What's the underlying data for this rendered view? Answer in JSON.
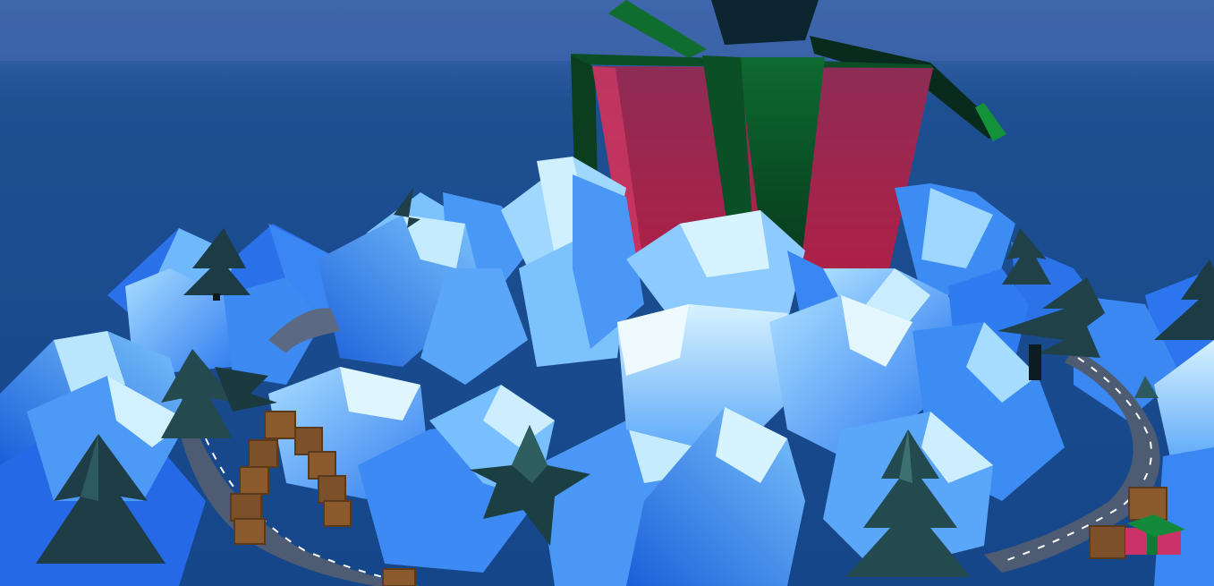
{
  "scene": {
    "sky_color": "#3f66ab",
    "sea_color": "#1a4e90",
    "horizon_color": "#2f5a9e",
    "ice_colors": [
      "#1d63e0",
      "#2f7bf0",
      "#4b98f7",
      "#6db6fb",
      "#9fd6ff",
      "#c8ecff"
    ],
    "gift_box_color": "#b52a55",
    "gift_ribbon_color": "#0f6a2e",
    "tree_color": "#1d3b45",
    "road_color": "#5b6a82",
    "crate_color": "#8a5a2c",
    "icons": [
      "gift-box",
      "pine-tree",
      "wooden-crate",
      "road",
      "ice-crystal"
    ]
  }
}
